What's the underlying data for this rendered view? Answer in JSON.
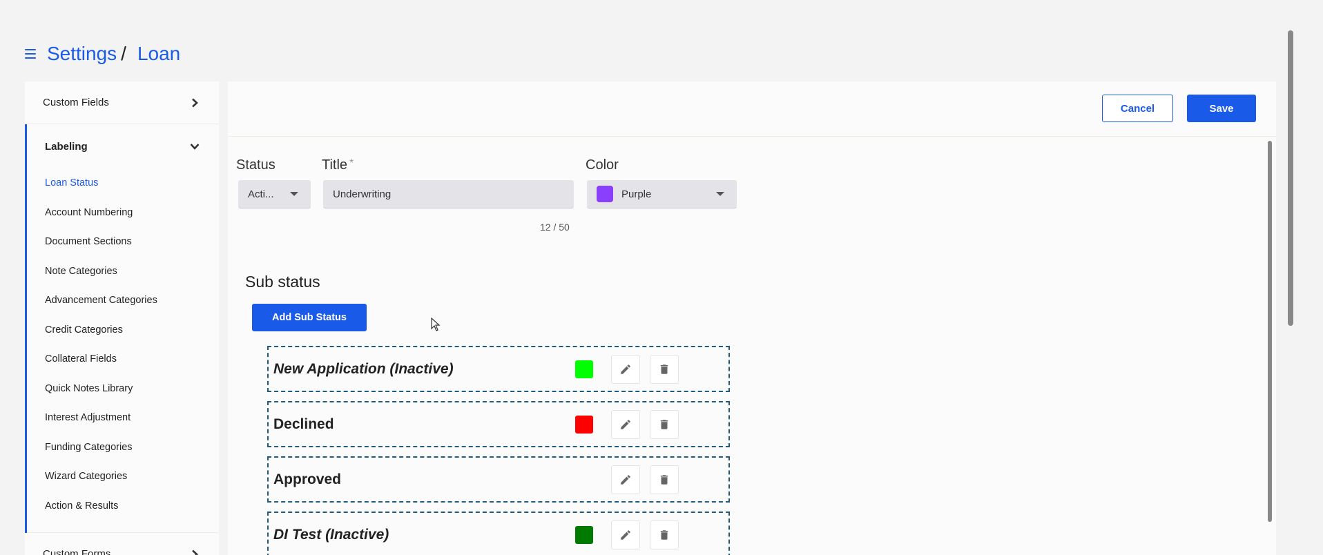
{
  "breadcrumb": {
    "root": "Settings",
    "separator": "/",
    "current": "Loan"
  },
  "sidebar": {
    "custom_fields": "Custom Fields",
    "labeling": "Labeling",
    "items": [
      {
        "label": "Loan Status",
        "active": true
      },
      {
        "label": "Account Numbering"
      },
      {
        "label": "Document Sections"
      },
      {
        "label": "Note Categories"
      },
      {
        "label": "Advancement Categories"
      },
      {
        "label": "Credit Categories"
      },
      {
        "label": "Collateral Fields"
      },
      {
        "label": "Quick Notes Library"
      },
      {
        "label": "Interest Adjustment"
      },
      {
        "label": "Funding Categories"
      },
      {
        "label": "Wizard Categories"
      },
      {
        "label": "Action & Results"
      }
    ],
    "custom_forms": "Custom Forms"
  },
  "actions": {
    "cancel": "Cancel",
    "save": "Save"
  },
  "form": {
    "status_label": "Status",
    "status_value": "Acti...",
    "title_label": "Title",
    "title_required_mark": "*",
    "title_value": "Underwriting",
    "title_counter": "12 / 50",
    "color_label": "Color",
    "color_value": "Purple",
    "color_hex": "#8a3ffc"
  },
  "sub_status": {
    "heading": "Sub status",
    "add_button": "Add Sub Status",
    "items": [
      {
        "title": "New Application (Inactive)",
        "italic": true,
        "color": "#00ff00"
      },
      {
        "title": "Declined",
        "italic": false,
        "color": "#ff0000"
      },
      {
        "title": "Approved",
        "italic": false,
        "color": null
      },
      {
        "title": "DI Test (Inactive)",
        "italic": true,
        "color": "#007a00"
      }
    ]
  },
  "icons": {
    "menu": "hamburger-icon",
    "edit": "pencil-icon",
    "delete": "trash-icon",
    "expand": "chevron-right-icon",
    "collapse": "chevron-down-icon"
  }
}
